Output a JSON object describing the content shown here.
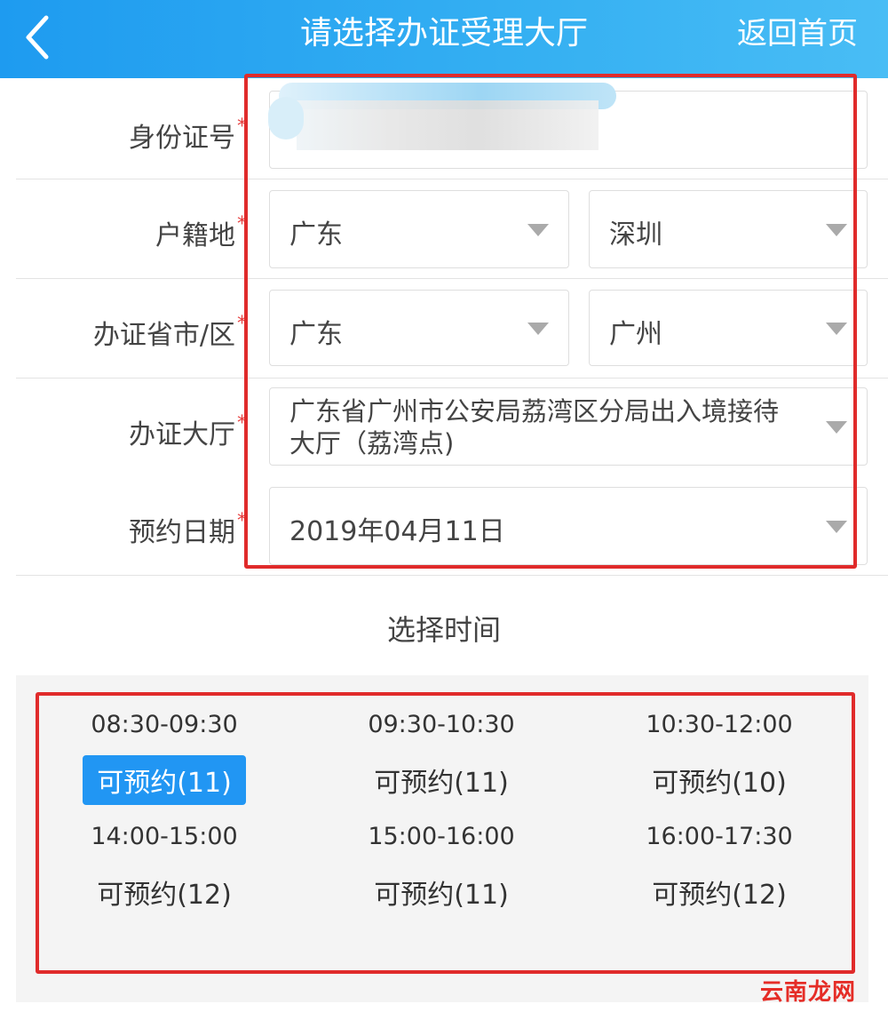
{
  "header": {
    "title": "请选择办证受理大厅",
    "home_label": "返回首页"
  },
  "form": {
    "id_number": {
      "label": "身份证号",
      "required_mark": "*"
    },
    "household": {
      "label": "户籍地",
      "required_mark": "*",
      "province": "广东",
      "city": "深圳"
    },
    "office_region": {
      "label": "办证省市/区",
      "required_mark": "*",
      "province": "广东",
      "city": "广州"
    },
    "hall": {
      "label": "办证大厅",
      "required_mark": "*",
      "value_line1": "广东省广州市公安局荔湾区分局出入境接待",
      "value_line2": "大厅（荔湾点)"
    },
    "date": {
      "label": "预约日期",
      "required_mark": "*",
      "value": "2019年04月11日"
    }
  },
  "time_section": {
    "title": "选择时间",
    "slots": [
      {
        "time": "08:30-09:30",
        "availability": "可预约(11)",
        "selected": true
      },
      {
        "time": "09:30-10:30",
        "availability": "可预约(11)",
        "selected": false
      },
      {
        "time": "10:30-12:00",
        "availability": "可预约(10)",
        "selected": false
      },
      {
        "time": "14:00-15:00",
        "availability": "可预约(12)",
        "selected": false
      },
      {
        "time": "15:00-16:00",
        "availability": "可预约(11)",
        "selected": false
      },
      {
        "time": "16:00-17:30",
        "availability": "可预约(12)",
        "selected": false
      }
    ]
  },
  "watermark": "云南龙网",
  "colors": {
    "header_blue": "#1e9bf0",
    "selected_blue": "#2196f3",
    "highlight_red": "#e02b2b",
    "required_red": "#e63b3b"
  }
}
